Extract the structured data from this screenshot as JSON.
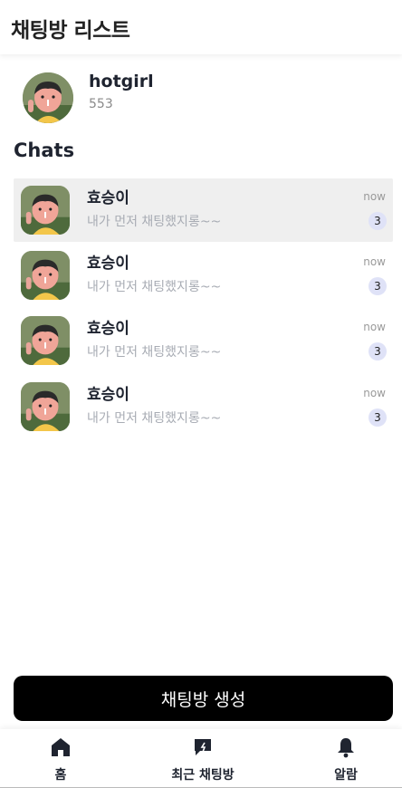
{
  "header": {
    "title": "채팅방 리스트"
  },
  "profile": {
    "name": "hotgirl",
    "sub": "553"
  },
  "chats_title": "Chats",
  "chats": [
    {
      "name": "효승이",
      "preview": "내가 먼저 채팅했지롱~~",
      "time": "now",
      "badge": "3"
    },
    {
      "name": "효승이",
      "preview": "내가 먼저 채팅했지롱~~",
      "time": "now",
      "badge": "3"
    },
    {
      "name": "효승이",
      "preview": "내가 먼저 채팅했지롱~~",
      "time": "now",
      "badge": "3"
    },
    {
      "name": "효승이",
      "preview": "내가 먼저 채팅했지롱~~",
      "time": "now",
      "badge": "3"
    }
  ],
  "create_button": "채팅방 생성",
  "tabs": [
    {
      "label": "홈",
      "icon": "home-icon"
    },
    {
      "label": "최근 채팅방",
      "icon": "chat-bubble-icon"
    },
    {
      "label": "알람",
      "icon": "bell-icon"
    }
  ],
  "colors": {
    "accent": "#000000",
    "badge_bg": "#dfe2f7",
    "active_row": "#efefef"
  }
}
